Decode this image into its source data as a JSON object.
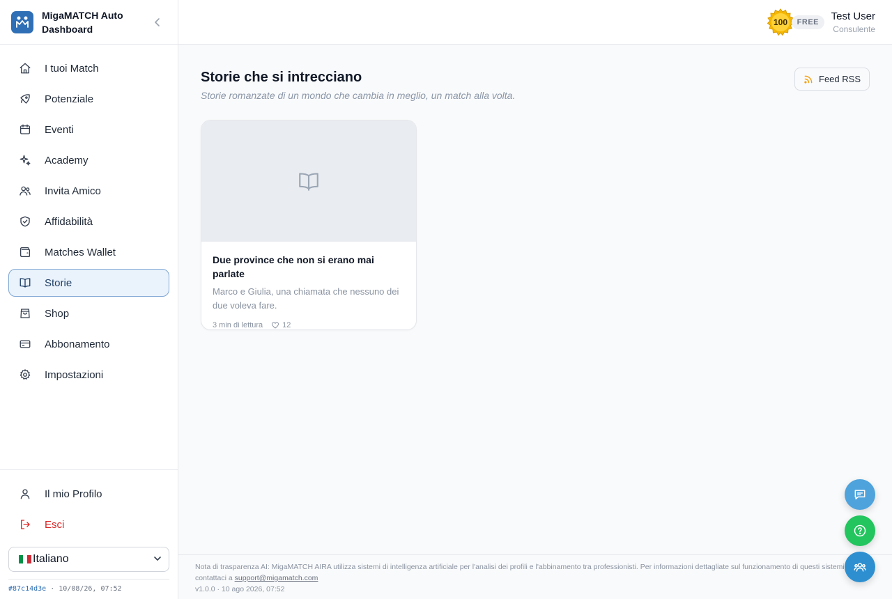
{
  "brand": {
    "title": "MigaMATCH Auto Dashboard"
  },
  "nav": {
    "items": [
      {
        "label": "I tuoi Match",
        "icon": "home-icon"
      },
      {
        "label": "Potenziale",
        "icon": "rocket-icon"
      },
      {
        "label": "Eventi",
        "icon": "calendar-icon"
      },
      {
        "label": "Academy",
        "icon": "sparkles-icon"
      },
      {
        "label": "Invita Amico",
        "icon": "users-icon"
      },
      {
        "label": "Affidabilità",
        "icon": "shield-check-icon"
      },
      {
        "label": "Matches Wallet",
        "icon": "wallet-icon"
      },
      {
        "label": "Storie",
        "icon": "book-open-icon",
        "active": true
      },
      {
        "label": "Shop",
        "icon": "shopping-bag-icon"
      },
      {
        "label": "Abbonamento",
        "icon": "credit-card-icon"
      },
      {
        "label": "Impostazioni",
        "icon": "gear-icon"
      }
    ],
    "profile_label": "Il mio Profilo",
    "logout_label": "Esci"
  },
  "language": {
    "selected": "Italiano"
  },
  "build": {
    "hash": "#87c14d3e",
    "timestamp": "· 10/08/26, 07:52"
  },
  "header": {
    "score_badge": "100",
    "plan": "FREE",
    "user_name": "Test User",
    "user_role": "Consulente"
  },
  "page": {
    "title": "Storie che si intrecciano",
    "subtitle": "Storie romanzate di un mondo che cambia in meglio, un match alla volta.",
    "rss_label": "Feed RSS"
  },
  "stories": [
    {
      "title": "Due province che non si erano mai parlate",
      "excerpt": "Marco e Giulia, una chiamata che nessuno dei due voleva fare.",
      "read_time": "3 min di lettura",
      "likes": "12"
    }
  ],
  "footer": {
    "note": "Nota di trasparenza AI: MigaMATCH AIRA utilizza sistemi di intelligenza artificiale per l'analisi dei profili e l'abbinamento tra professionisti. Per informazioni dettagliate sul funzionamento di questi sistemi,",
    "contact_prefix": "contattaci a ",
    "contact_email": "support@migamatch.com",
    "version": "v1.0.0 · 10 ago 2026, 07:52"
  },
  "colors": {
    "brand": "#2f6fb5",
    "active_bg": "#eaf2fb",
    "active_border": "#7ea6d3",
    "danger": "#dc2626",
    "rss_orange": "#f59e0b",
    "fab_chat": "#4ea3dc",
    "fab_help": "#22c55e",
    "fab_team": "#2d8fd0"
  }
}
